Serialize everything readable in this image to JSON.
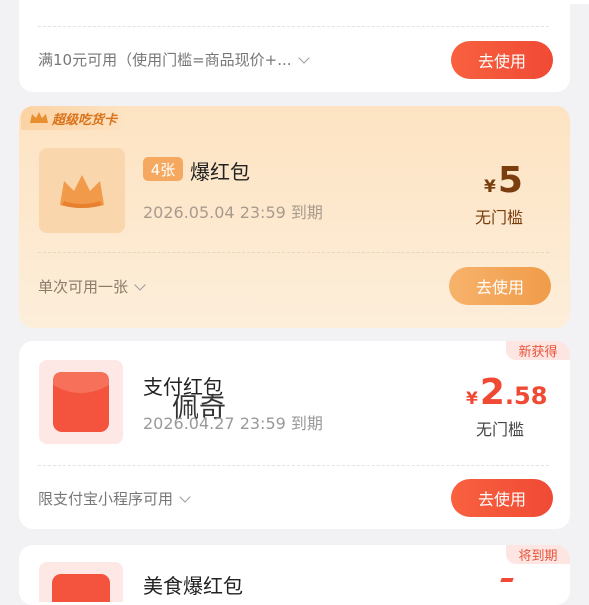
{
  "top_card": {
    "condition": "满10元可用（使用门槛=商品现价+...",
    "button": "去使用"
  },
  "super_card": {
    "badge": "超级吃货卡",
    "count_tag": "4张",
    "title": "爆红包",
    "expiry": "2026.05.04 23:59 到期",
    "currency": "¥",
    "amount": "5",
    "threshold": "无门槛",
    "condition": "单次可用一张",
    "button": "去使用"
  },
  "pay_card": {
    "corner_tag": "新获得",
    "title": "支付红包",
    "watermark": "佩奇",
    "expiry": "2026.04.27 23:59 到期",
    "currency": "¥",
    "amount_int": "2",
    "amount_dec": ".58",
    "threshold": "无门槛",
    "condition": "限支付宝小程序可用",
    "button": "去使用"
  },
  "food_card": {
    "corner_tag": "将到期",
    "title": "美食爆红包"
  },
  "colors": {
    "accent_red": "#f04a35",
    "super_bg": "#fde7c9",
    "text_gray": "#999999"
  }
}
